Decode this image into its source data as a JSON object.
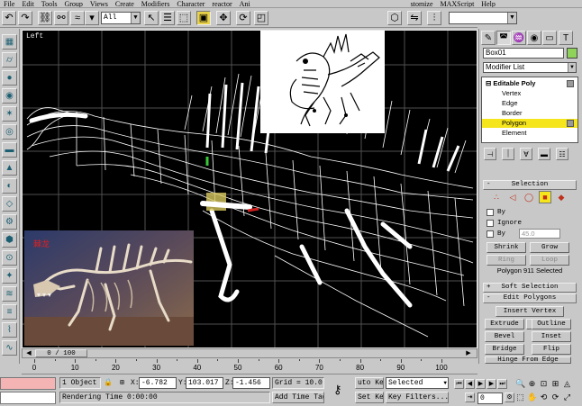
{
  "menu": {
    "items": [
      "File",
      "Edit",
      "Tools",
      "Group",
      "Views",
      "Create",
      "Modifiers",
      "Character",
      "reactor",
      "Ani",
      "",
      "",
      "",
      "",
      "",
      "stomize",
      "MAXScript",
      "Help"
    ]
  },
  "toolbar": {
    "selection_filter": "All",
    "icons": [
      "undo-icon",
      "redo-icon",
      "select-link-icon",
      "unlink-icon",
      "bind-spacewarp-icon",
      "select-object-icon",
      "select-by-name-icon",
      "region-select-icon",
      "move-icon",
      "rotate-icon"
    ]
  },
  "viewport": {
    "label": "Left",
    "photo_caption": "棘龙"
  },
  "command_panel": {
    "tabs": [
      "create-icon",
      "modify-icon",
      "hierarchy-icon",
      "motion-icon",
      "display-icon",
      "utilities-icon"
    ],
    "object_name": "Box01",
    "object_color": "#8fd35a",
    "modifier_list_label": "Modifier List",
    "stack": {
      "top": "Editable Poly",
      "subs": [
        "Vertex",
        "Edge",
        "Border",
        "Polygon",
        "Element"
      ],
      "selected": "Polygon"
    },
    "selection": {
      "header": "Selection",
      "by_vertex_label": "By",
      "ignore_backfacing_label": "Ignore",
      "by_angle_label": "By",
      "angle_value": "45.0",
      "shrink": "Shrink",
      "grow": "Grow",
      "ring": "Ring",
      "loop": "Loop",
      "info": "Polygon 911 Selected"
    },
    "soft_selection": {
      "header": "Soft Selection"
    },
    "edit_polygons": {
      "header": "Edit Polygons",
      "insert_vertex": "Insert Vertex",
      "extrude": "Extrude",
      "outline": "Outline",
      "bevel": "Bevel",
      "inset": "Inset",
      "bridge": "Bridge",
      "flip": "Flip",
      "hinge": "Hinge From Edge"
    }
  },
  "timeline": {
    "position_label": "0 / 100",
    "ticks": [
      "0",
      "10",
      "20",
      "30",
      "40",
      "50",
      "60",
      "70",
      "80",
      "90",
      "100"
    ]
  },
  "status": {
    "selection_count": "1 Object",
    "x_label": "X:",
    "x_value": "-6.782",
    "y_label": "Y:",
    "y_value": "103.017",
    "z_label": "Z:",
    "z_value": "-1.456",
    "grid": "Grid = 10.0",
    "prompt": "Rendering Time  0:00:00",
    "add_time_tag": "Add Time Tag",
    "auto_key": "uto Ke",
    "set_key": "Set Key",
    "key_mode": "Selected",
    "key_filters": "Key Filters...",
    "frame": "0"
  }
}
